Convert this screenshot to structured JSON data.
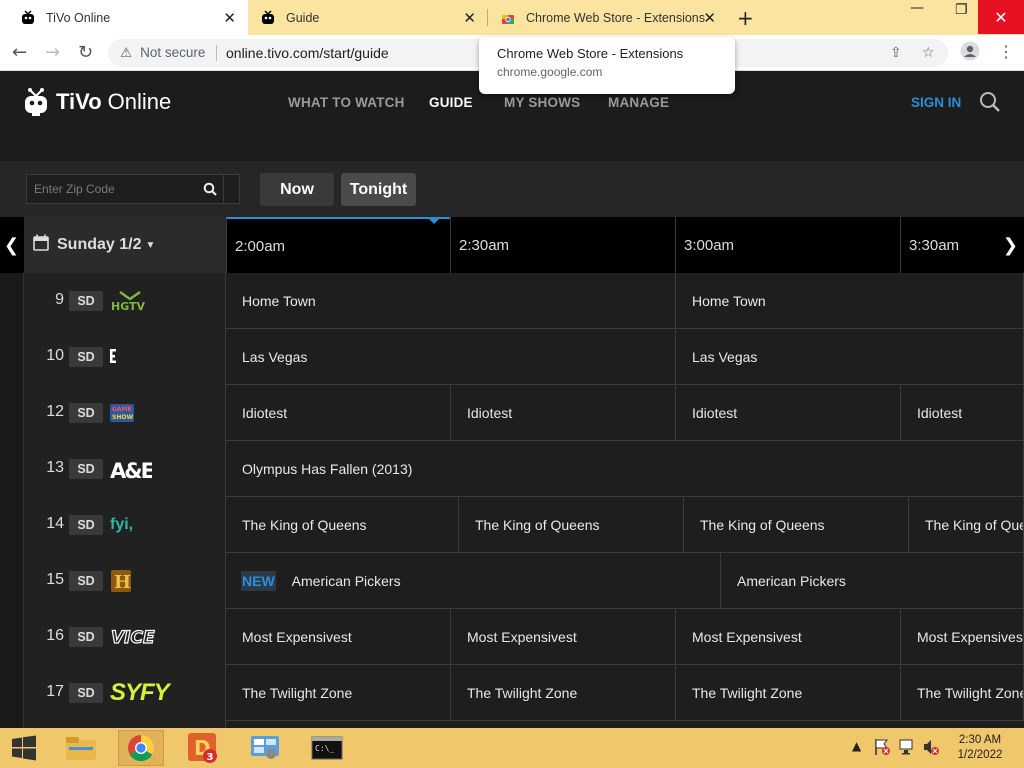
{
  "browser": {
    "tabs": [
      {
        "title": "TiVo Online",
        "icon": "tivo-icon",
        "active": true
      },
      {
        "title": "Guide",
        "icon": "tivo-icon",
        "active": false
      },
      {
        "title": "Chrome Web Store - Extensions",
        "icon": "chrome-webstore-icon",
        "active": false
      }
    ],
    "security_label": "Not secure",
    "url": "online.tivo.com/start/guide",
    "tooltip": {
      "title": "Chrome Web Store - Extensions",
      "subtitle": "chrome.google.com"
    }
  },
  "tivo": {
    "logo_brand": "TiVo",
    "logo_suffix": "Online",
    "nav": [
      "WHAT TO WATCH",
      "GUIDE",
      "MY SHOWS",
      "MANAGE"
    ],
    "active_nav": "GUIDE",
    "signin": "SIGN IN",
    "zip_placeholder": "Enter Zip Code",
    "btn_now": "Now",
    "btn_tonight": "Tonight",
    "date": "Sunday 1/2",
    "times": [
      "2:00am",
      "2:30am",
      "3:00am",
      "3:30am"
    ]
  },
  "channels": [
    {
      "num": "9",
      "quality": "SD",
      "logo": "HGTV",
      "programs": [
        {
          "title": "Home Town"
        },
        {
          "title": "Home Town"
        }
      ]
    },
    {
      "num": "10",
      "quality": "SD",
      "logo": "E!",
      "programs": [
        {
          "title": "Las Vegas"
        },
        {
          "title": "Las Vegas"
        }
      ]
    },
    {
      "num": "12",
      "quality": "SD",
      "logo": "GAME SHOW",
      "programs": [
        {
          "title": "Idiotest"
        },
        {
          "title": "Idiotest"
        },
        {
          "title": "Idiotest"
        },
        {
          "title": "Idiotest"
        }
      ]
    },
    {
      "num": "13",
      "quality": "SD",
      "logo": "A&E",
      "programs": [
        {
          "title": "Olympus Has Fallen (2013)"
        }
      ]
    },
    {
      "num": "14",
      "quality": "SD",
      "logo": "fyi,",
      "programs": [
        {
          "title": "The King of Queens"
        },
        {
          "title": "The King of Queens"
        },
        {
          "title": "The King of Queens"
        },
        {
          "title": "The King of Queens"
        }
      ]
    },
    {
      "num": "15",
      "quality": "SD",
      "logo": "H",
      "programs": [
        {
          "title": "American Pickers",
          "badge": "NEW"
        },
        {
          "title": "American Pickers"
        }
      ]
    },
    {
      "num": "16",
      "quality": "SD",
      "logo": "VICE",
      "programs": [
        {
          "title": "Most Expensivest"
        },
        {
          "title": "Most Expensivest"
        },
        {
          "title": "Most Expensivest"
        },
        {
          "title": "Most Expensivest"
        }
      ]
    },
    {
      "num": "17",
      "quality": "SD",
      "logo": "SYFY",
      "programs": [
        {
          "title": "The Twilight Zone"
        },
        {
          "title": "The Twilight Zone"
        },
        {
          "title": "The Twilight Zone"
        },
        {
          "title": "The Twilight Zone"
        }
      ]
    }
  ],
  "taskbar": {
    "clock_time": "2:30 AM",
    "clock_date": "1/2/2022",
    "badge_count": "3"
  },
  "colors": {
    "accent": "#2b8fd6",
    "tabbar": "#fbe3a0",
    "taskbar": "#f1c76c"
  }
}
